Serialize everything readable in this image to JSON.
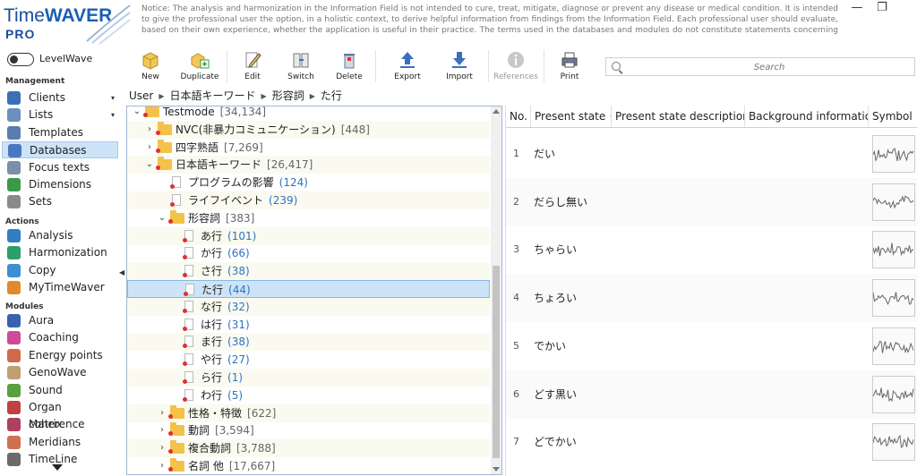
{
  "app": {
    "brand_time": "Time",
    "brand_waver": "WAVER",
    "brand_edition": "PRO",
    "notice": "Notice: The analysis and harmonization in the Information Field is not intended to cure, treat, mitigate, diagnose or prevent any disease or medical condition. It is intended to give the professional user the option, in a holistic context, to derive helpful information from findings from the Information Field. Each professional user should evaluate, based on their own experience, whether the application is useful in their practice. The terms used in the databases and modules do not constitute statements concerning their effects. Information from the TimeWaver system should always be ...",
    "window_minimize": "—",
    "window_restore": "❐"
  },
  "levelwave": {
    "label": "LevelWave"
  },
  "sidebar": {
    "management_title": "Management",
    "management": [
      {
        "label": "Clients",
        "icon": "clients-icon",
        "color": "#3b6fb6",
        "arrow": "▾"
      },
      {
        "label": "Lists",
        "icon": "lists-icon",
        "color": "#6a8fc0",
        "arrow": "▾"
      },
      {
        "label": "Templates",
        "icon": "templates-icon",
        "color": "#5a7db0",
        "arrow": ""
      },
      {
        "label": "Databases",
        "icon": "databases-icon",
        "color": "#4a78c0",
        "arrow": ""
      },
      {
        "label": "Focus texts",
        "icon": "focus-texts-icon",
        "color": "#7b8fa8",
        "arrow": ""
      },
      {
        "label": "Dimensions",
        "icon": "dimensions-icon",
        "color": "#3a9a4a",
        "arrow": ""
      },
      {
        "label": "Sets",
        "icon": "sets-icon",
        "color": "#8a8a8a",
        "arrow": ""
      }
    ],
    "actions_title": "Actions",
    "actions": [
      {
        "label": "Analysis",
        "icon": "analysis-icon",
        "color": "#2f7fc4"
      },
      {
        "label": "Harmonization",
        "icon": "harmonization-icon",
        "color": "#2aa06a"
      },
      {
        "label": "Copy",
        "icon": "copy-icon",
        "color": "#3c8fd0"
      },
      {
        "label": "MyTimeWaver",
        "icon": "mytimewaver-icon",
        "color": "#e08a2a"
      }
    ],
    "modules_title": "Modules",
    "modules": [
      {
        "label": "Aura",
        "icon": "aura-icon",
        "color": "#3a60b0"
      },
      {
        "label": "Coaching",
        "icon": "coaching-icon",
        "color": "#d04a9a"
      },
      {
        "label": "Energy points",
        "icon": "energy-points-icon",
        "color": "#d06a4a"
      },
      {
        "label": "GenoWave",
        "icon": "genowave-icon",
        "color": "#c0a070"
      },
      {
        "label": "Sound",
        "icon": "sound-icon",
        "color": "#5aa040"
      },
      {
        "label": "Organ coherence",
        "icon": "organ-coherence-icon",
        "color": "#c04040"
      },
      {
        "label": "Matrix",
        "icon": "matrix-icon",
        "color": "#b04060"
      },
      {
        "label": "Meridians",
        "icon": "meridians-icon",
        "color": "#d07050"
      },
      {
        "label": "TimeLine",
        "icon": "timeline-icon",
        "color": "#6a6a6a"
      }
    ]
  },
  "toolbar": {
    "new": "New",
    "duplicate": "Duplicate",
    "edit": "Edit",
    "switch": "Switch",
    "delete": "Delete",
    "export": "Export",
    "import": "Import",
    "references": "References",
    "print": "Print"
  },
  "search": {
    "placeholder": "Search"
  },
  "breadcrumb": [
    "User",
    "日本語キーワード",
    "形容詞",
    "た行"
  ],
  "tree": [
    {
      "label": "Testmode",
      "count": "[34,134]",
      "exp": "⌄",
      "type": "folder",
      "level": 0
    },
    {
      "label": "NVC(非暴力コミュニケーション)",
      "count": "[448]",
      "exp": "›",
      "type": "folder",
      "level": 1
    },
    {
      "label": "四字熟語",
      "count": "[7,269]",
      "exp": "›",
      "type": "folder",
      "level": 1
    },
    {
      "label": "日本語キーワード",
      "count": "[26,417]",
      "exp": "⌄",
      "type": "folder",
      "level": 1
    },
    {
      "label": "プログラムの影響",
      "count": "(124)",
      "exp": "",
      "type": "doc",
      "level": 2,
      "link": true
    },
    {
      "label": "ライフイベント",
      "count": "(239)",
      "exp": "",
      "type": "doc",
      "level": 2,
      "link": true
    },
    {
      "label": "形容詞",
      "count": "[383]",
      "exp": "⌄",
      "type": "folder",
      "level": 2
    },
    {
      "label": "あ行",
      "count": "(101)",
      "exp": "",
      "type": "doc",
      "level": 3,
      "link": true
    },
    {
      "label": "か行",
      "count": "(66)",
      "exp": "",
      "type": "doc",
      "level": 3,
      "link": true
    },
    {
      "label": "さ行",
      "count": "(38)",
      "exp": "",
      "type": "doc",
      "level": 3,
      "link": true
    },
    {
      "label": "た行",
      "count": "(44)",
      "exp": "",
      "type": "doc",
      "level": 3,
      "link": true,
      "selected": true
    },
    {
      "label": "な行",
      "count": "(32)",
      "exp": "",
      "type": "doc",
      "level": 3,
      "link": true
    },
    {
      "label": "は行",
      "count": "(31)",
      "exp": "",
      "type": "doc",
      "level": 3,
      "link": true
    },
    {
      "label": "ま行",
      "count": "(38)",
      "exp": "",
      "type": "doc",
      "level": 3,
      "link": true
    },
    {
      "label": "や行",
      "count": "(27)",
      "exp": "",
      "type": "doc",
      "level": 3,
      "link": true
    },
    {
      "label": "ら行",
      "count": "(1)",
      "exp": "",
      "type": "doc",
      "level": 3,
      "link": true
    },
    {
      "label": "わ行",
      "count": "(5)",
      "exp": "",
      "type": "doc",
      "level": 3,
      "link": true
    },
    {
      "label": "性格・特徴",
      "count": "[622]",
      "exp": "›",
      "type": "folder",
      "level": 2
    },
    {
      "label": "動詞",
      "count": "[3,594]",
      "exp": "›",
      "type": "folder",
      "level": 2
    },
    {
      "label": "複合動詞",
      "count": "[3,788]",
      "exp": "›",
      "type": "folder",
      "level": 2
    },
    {
      "label": "名詞 他",
      "count": "[17,667]",
      "exp": "›",
      "type": "folder",
      "level": 2
    }
  ],
  "table": {
    "columns": {
      "no": "No.",
      "present_state": "Present state",
      "sort_arrow": "^",
      "description": "Present state description",
      "background": "Background information",
      "symbol": "Symbol"
    },
    "rows": [
      {
        "no": "1",
        "state": "だい"
      },
      {
        "no": "2",
        "state": "だらし無い"
      },
      {
        "no": "3",
        "state": "ちゃらい"
      },
      {
        "no": "4",
        "state": "ちょろい"
      },
      {
        "no": "5",
        "state": "でかい"
      },
      {
        "no": "6",
        "state": "どす黒い"
      },
      {
        "no": "7",
        "state": "どでかい"
      }
    ]
  }
}
